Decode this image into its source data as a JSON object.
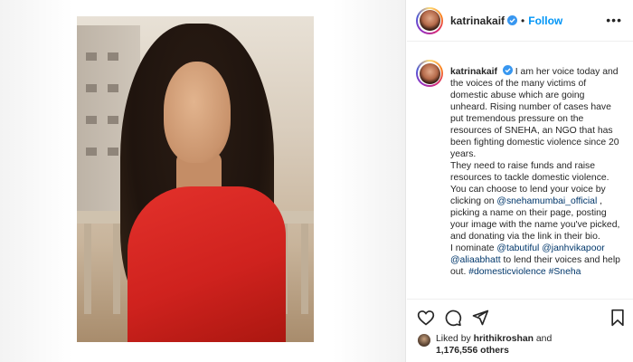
{
  "post": {
    "username": "katrinakaif",
    "follow_label": "Follow",
    "dot": "•",
    "more_label": "•••"
  },
  "caption": {
    "username": "katrinakaif",
    "part1": "I am her voice today and the voices of the many victims of domestic abuse which are going unheard. Rising number of cases have put tremendous pressure on the resources of SNEHA, an NGO that has been fighting domestic violence since 20 years.",
    "part2": "They need to raise funds and raise resources to tackle domestic violence. You can choose to lend your voice by clicking on ",
    "mention_sneha": "@snehamumbai_official",
    "part3": " , picking a name on their page, posting your image with the name you've picked, and donating via the link in their bio.",
    "part4": "I nominate ",
    "mention_tabutiful": "@tabutiful",
    "mention_janhvi": "@janhvikapoor",
    "mention_alia": "@aliaabhatt",
    "part5": " to lend their voices and help out. ",
    "hashtag": "#domesticviolence #Sneha"
  },
  "likes": {
    "prefix": "Liked by ",
    "liker": "hrithikroshan",
    "and": " and",
    "count": "1,176,556 others"
  },
  "icons": {
    "like": "heart-icon",
    "comment": "comment-icon",
    "share": "share-icon",
    "save": "bookmark-icon"
  },
  "colors": {
    "link": "#00376b",
    "follow": "#0095f6",
    "verified": "#3897f0"
  }
}
